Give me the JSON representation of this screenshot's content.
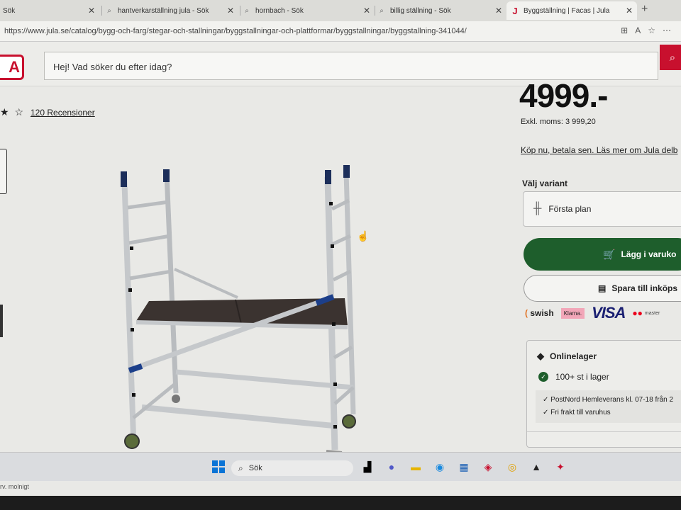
{
  "tabs": [
    {
      "label": "Sök",
      "icon": "search-icon"
    },
    {
      "label": "hantverkarställning jula - Sök",
      "icon": "search-icon"
    },
    {
      "label": "hornbach - Sök",
      "icon": "search-icon"
    },
    {
      "label": "billig ställning - Sök",
      "icon": "search-icon"
    },
    {
      "label": "Byggställning | Facas | Jula",
      "icon": "jula-favicon-icon"
    }
  ],
  "address_bar": {
    "url": "https://www.jula.se/catalog/bygg-och-farg/stegar-och-stallningar/byggstallningar-och-plattformar/byggstallningar/byggstallning-341044/"
  },
  "header": {
    "logo_text": "A",
    "search_placeholder": "Hej! Vad söker du efter idag?"
  },
  "product": {
    "rating_stars": "★ ☆",
    "reviews": "120 Recensioner",
    "price": "4999.-",
    "price_ex_vat": "Exkl. moms: 3 999,20",
    "finance_link": "Köp nu, betala sen. Läs mer om Jula delb",
    "variant_label": "Välj variant",
    "variant_value": "Första plan",
    "add_to_cart": "Lägg i varuko",
    "save_to_list": "Spara till inköps"
  },
  "payments": {
    "swish": "swish",
    "klarna": "Klarna.",
    "visa": "VISA",
    "mastercard": "master"
  },
  "stock": {
    "title": "Onlinelager",
    "quantity": "100+ st i lager",
    "shipping_lines": [
      "PostNord Hemleverans kl. 07-18 från 2",
      "Fri frakt till varuhus"
    ]
  },
  "taskbar": {
    "search_label": "Sök"
  },
  "status": {
    "text": "rv. molnigt"
  },
  "colors": {
    "brand_red": "#c8102e",
    "cart_green": "#1e5e2c"
  }
}
